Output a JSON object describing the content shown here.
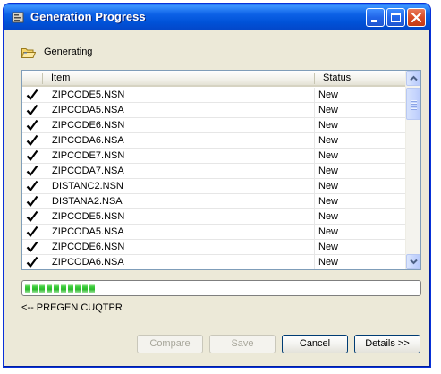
{
  "window": {
    "title": "Generation Progress"
  },
  "status_header": {
    "label": "Generating"
  },
  "table": {
    "columns": [
      "Item",
      "Status"
    ],
    "rows": [
      {
        "item": "ZIPCODE5.NSN",
        "status": "New",
        "checked": true
      },
      {
        "item": "ZIPCODA5.NSA",
        "status": "New",
        "checked": true
      },
      {
        "item": "ZIPCODE6.NSN",
        "status": "New",
        "checked": true
      },
      {
        "item": "ZIPCODA6.NSA",
        "status": "New",
        "checked": true
      },
      {
        "item": "ZIPCODE7.NSN",
        "status": "New",
        "checked": true
      },
      {
        "item": "ZIPCODA7.NSA",
        "status": "New",
        "checked": true
      },
      {
        "item": "DISTANC2.NSN",
        "status": "New",
        "checked": true
      },
      {
        "item": "DISTANA2.NSA",
        "status": "New",
        "checked": true
      },
      {
        "item": "ZIPCODE5.NSN",
        "status": "New",
        "checked": true
      },
      {
        "item": "ZIPCODA5.NSA",
        "status": "New",
        "checked": true
      },
      {
        "item": "ZIPCODE6.NSN",
        "status": "New",
        "checked": true
      },
      {
        "item": "ZIPCODA6.NSA",
        "status": "New",
        "checked": true
      }
    ]
  },
  "progress": {
    "fraction": 0.18,
    "color": "#3ecf3e"
  },
  "status_text": "<-- PREGEN CUQTPR",
  "buttons": {
    "compare": "Compare",
    "save": "Save",
    "cancel": "Cancel",
    "details": "Details >>"
  },
  "colors": {
    "titlebar": "#0c61e6",
    "close_button": "#d94c25",
    "dialog_bg": "#ece9d8"
  }
}
